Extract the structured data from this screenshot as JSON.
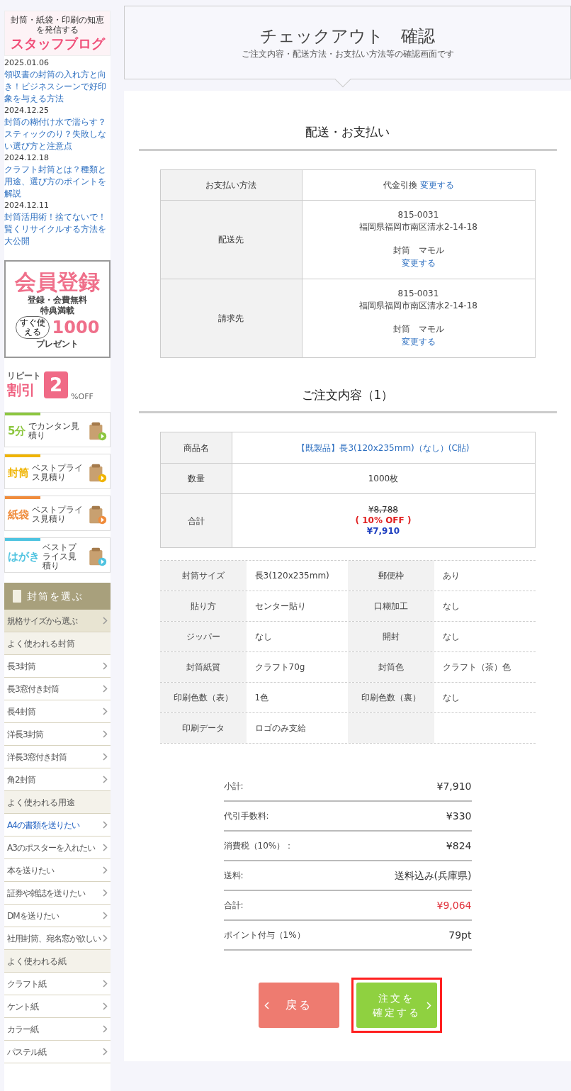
{
  "sidebar": {
    "banners": [
      {
        "kind": "blog",
        "caption": "封筒・紙袋・印刷の知恵を発信する",
        "title": "スタッフブログ"
      }
    ],
    "blog_posts": [
      {
        "date": "2025.01.06",
        "title": "領収書の封筒の入れ方と向き！ビジネスシーンで好印象を与える方法"
      },
      {
        "date": "2024.12.25",
        "title": "封筒の糊付け水で濡らす？スティックのり？失敗しない選び方と注意点"
      },
      {
        "date": "2024.12.18",
        "title": "クラフト封筒とは？種類と用途、選び方のポイントを解説"
      },
      {
        "date": "2024.12.11",
        "title": "封筒活用術！捨てないで！賢くリサイクルする方法を大公開"
      }
    ],
    "promo_banners": [
      {
        "kind": "member",
        "title": "会員登録",
        "lines": [
          "登録・会費無料",
          "特典満載"
        ],
        "bubble": "すぐ使える",
        "amount": "1000",
        "tail": "プレゼント"
      },
      {
        "kind": "repeat",
        "top": "リピート",
        "title": "割引",
        "amount": "2",
        "unit": "%OFF"
      },
      {
        "kind": "estimate",
        "color": "#8cc63f",
        "big": "5分",
        "sub": "でカンタン見積り"
      },
      {
        "kind": "estimate",
        "color": "#f0b400",
        "big": "封筒",
        "sub": "ベストプライス見積り"
      },
      {
        "kind": "estimate",
        "color": "#f08c3c",
        "big": "紙袋",
        "sub": "ベストプライス見積り"
      },
      {
        "kind": "estimate",
        "color": "#4fc3e0",
        "big": "はがき",
        "sub": "ベストプライス見積り"
      }
    ],
    "menu": {
      "title": "封筒を選ぶ",
      "items": [
        {
          "kind": "featured",
          "label": "規格サイズから選ぶ",
          "selected": false
        },
        {
          "kind": "section",
          "label": "よく使われる封筒"
        },
        {
          "kind": "link",
          "label": "長3封筒",
          "selected": false
        },
        {
          "kind": "link",
          "label": "長3窓付き封筒",
          "selected": false
        },
        {
          "kind": "link",
          "label": "長4封筒",
          "selected": false
        },
        {
          "kind": "link",
          "label": "洋長3封筒",
          "selected": false
        },
        {
          "kind": "link",
          "label": "洋長3窓付き封筒",
          "selected": false
        },
        {
          "kind": "link",
          "label": "角2封筒",
          "selected": false
        },
        {
          "kind": "section",
          "label": "よく使われる用途"
        },
        {
          "kind": "link",
          "label": "A4の書類を送りたい",
          "selected": true
        },
        {
          "kind": "link",
          "label": "A3のポスターを入れたい",
          "selected": false
        },
        {
          "kind": "link",
          "label": "本を送りたい",
          "selected": false
        },
        {
          "kind": "link",
          "label": "証券や雑誌を送りたい",
          "selected": false
        },
        {
          "kind": "link",
          "label": "DMを送りたい",
          "selected": false
        },
        {
          "kind": "link",
          "label": "社用封筒、宛名窓が欲しい",
          "selected": false
        },
        {
          "kind": "section",
          "label": "よく使われる紙"
        },
        {
          "kind": "link",
          "label": "クラフト紙",
          "selected": false
        },
        {
          "kind": "link",
          "label": "ケント紙",
          "selected": false
        },
        {
          "kind": "link",
          "label": "カラー紙",
          "selected": false
        },
        {
          "kind": "link",
          "label": "パステル紙",
          "selected": false
        }
      ]
    }
  },
  "header": {
    "title": "チェックアウト　確認",
    "subtitle": "ご注文内容・配送方法・お支払い方法等の確認画面です"
  },
  "delivery": {
    "heading": "配送・お支払い",
    "rows": [
      {
        "kind": "payment",
        "label": "お支払い方法",
        "value": "代金引換",
        "link": "変更する"
      },
      {
        "kind": "address",
        "label": "配送先",
        "zip": "815-0031",
        "address": "福岡県福岡市南区清水2-14-18",
        "name": "封筒　マモル",
        "link": "変更する"
      },
      {
        "kind": "address",
        "label": "請求先",
        "zip": "815-0031",
        "address": "福岡県福岡市南区清水2-14-18",
        "name": "封筒　マモル",
        "link": "変更する"
      }
    ]
  },
  "order": {
    "heading": "ご注文内容（1）",
    "rows": [
      {
        "kind": "product",
        "label": "商品名",
        "value": "【既製品】長3(120x235mm)（なし）(C貼)"
      },
      {
        "kind": "text",
        "label": "数量",
        "value": "1000枚"
      },
      {
        "kind": "price",
        "label": "合計",
        "original": "¥8,788",
        "discount": "( 10% OFF )",
        "price": "¥7,910"
      }
    ],
    "specs": [
      [
        {
          "label": "封筒サイズ",
          "value": "長3(120x235mm)"
        },
        {
          "label": "郵便枠",
          "value": "あり"
        }
      ],
      [
        {
          "label": "貼り方",
          "value": "センター貼り"
        },
        {
          "label": "口糊加工",
          "value": "なし"
        }
      ],
      [
        {
          "label": "ジッパー",
          "value": "なし"
        },
        {
          "label": "開封",
          "value": "なし"
        }
      ],
      [
        {
          "label": "封筒紙質",
          "value": "クラフト70g"
        },
        {
          "label": "封筒色",
          "value": "クラフト（茶）色"
        }
      ],
      [
        {
          "label": "印刷色数（表）",
          "value": "1色"
        },
        {
          "label": "印刷色数（裏）",
          "value": "なし"
        }
      ],
      [
        {
          "label": "印刷データ",
          "value": "ロゴのみ支給"
        }
      ]
    ]
  },
  "summary": [
    {
      "kind": "plain",
      "label": "小計:",
      "value": "¥7,910"
    },
    {
      "kind": "plain",
      "label": "代引手数料:",
      "value": "¥330"
    },
    {
      "kind": "plain",
      "label": "消費税（10%）：",
      "value": "¥824"
    },
    {
      "kind": "plain",
      "label": "送料:",
      "value": "送料込み(兵庫県)"
    },
    {
      "kind": "total",
      "label": "合計:",
      "value": "¥9,064"
    },
    {
      "kind": "plain",
      "label": "ポイント付与（1%）",
      "value": "79pt"
    }
  ],
  "buttons": [
    {
      "kind": "back",
      "lines": [
        "戻る"
      ],
      "highlighted": false
    },
    {
      "kind": "confirm",
      "lines": [
        "注文を",
        "確定する"
      ],
      "highlighted": true
    }
  ]
}
